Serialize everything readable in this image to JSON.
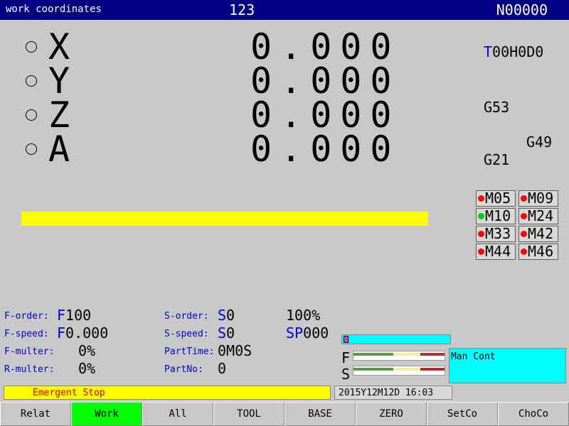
{
  "title_bar": {
    "mode": "work coordinates",
    "program": "123",
    "block": "N00000"
  },
  "axes": [
    {
      "name": "X",
      "value": "0.000"
    },
    {
      "name": "Y",
      "value": "0.000"
    },
    {
      "name": "Z",
      "value": "0.000"
    },
    {
      "name": "A",
      "value": "0.000"
    }
  ],
  "tool_info": {
    "prefix": "T",
    "rest": "00H0D0"
  },
  "gcodes": {
    "coord": "G53",
    "tool_len": "G49",
    "units": "G21"
  },
  "mcodes": [
    {
      "code": "M05",
      "status": "off",
      "color": "#ff0000"
    },
    {
      "code": "M09",
      "status": "off",
      "color": "#ff0000"
    },
    {
      "code": "M10",
      "status": "on",
      "color": "#00cc00"
    },
    {
      "code": "M24",
      "status": "off",
      "color": "#ff0000"
    },
    {
      "code": "M33",
      "status": "off",
      "color": "#ff0000"
    },
    {
      "code": "M42",
      "status": "off",
      "color": "#ff0000"
    },
    {
      "code": "M44",
      "status": "off",
      "color": "#ff0000"
    },
    {
      "code": "M46",
      "status": "off",
      "color": "#ff0000"
    }
  ],
  "feed": {
    "order_label": "F-order:",
    "order_prefix": "F",
    "order_value": "100",
    "speed_label": "F-speed:",
    "speed_prefix": "F",
    "speed_value": "0.000",
    "multer_label": "F-multer:",
    "multer_value": "0%",
    "r_multer_label": "R-multer:",
    "r_multer_value": "0%"
  },
  "spindle": {
    "order_label": "S-order:",
    "order_prefix": "S",
    "order_value": "0",
    "speed_label": "S-speed:",
    "speed_prefix": "S",
    "speed_value": "0",
    "percent": "100%",
    "sp_prefix": "SP",
    "sp_value": "000",
    "parttime_label": "PartTime:",
    "parttime_value": "0M0S",
    "partno_label": "PartNo:",
    "partno_value": "0"
  },
  "meters": {
    "f_label": "F",
    "s_label": "S"
  },
  "mode_panel": "Man Cont",
  "status": "Emergent Stop",
  "datetime": "2015Y12M12D 16:03",
  "softkeys": [
    "Relat",
    "Work",
    "All",
    "TOOL",
    "BASE",
    "ZERO",
    "SetCo",
    "ChoCo"
  ],
  "active_softkey": "Work",
  "colors": {
    "title_bg": "#000080",
    "panel_bg": "#c8c8c8",
    "accent_blue": "#0000cc",
    "warning_yellow": "#ffff00",
    "cyan": "#00ffff",
    "active_green": "#00ff00"
  }
}
